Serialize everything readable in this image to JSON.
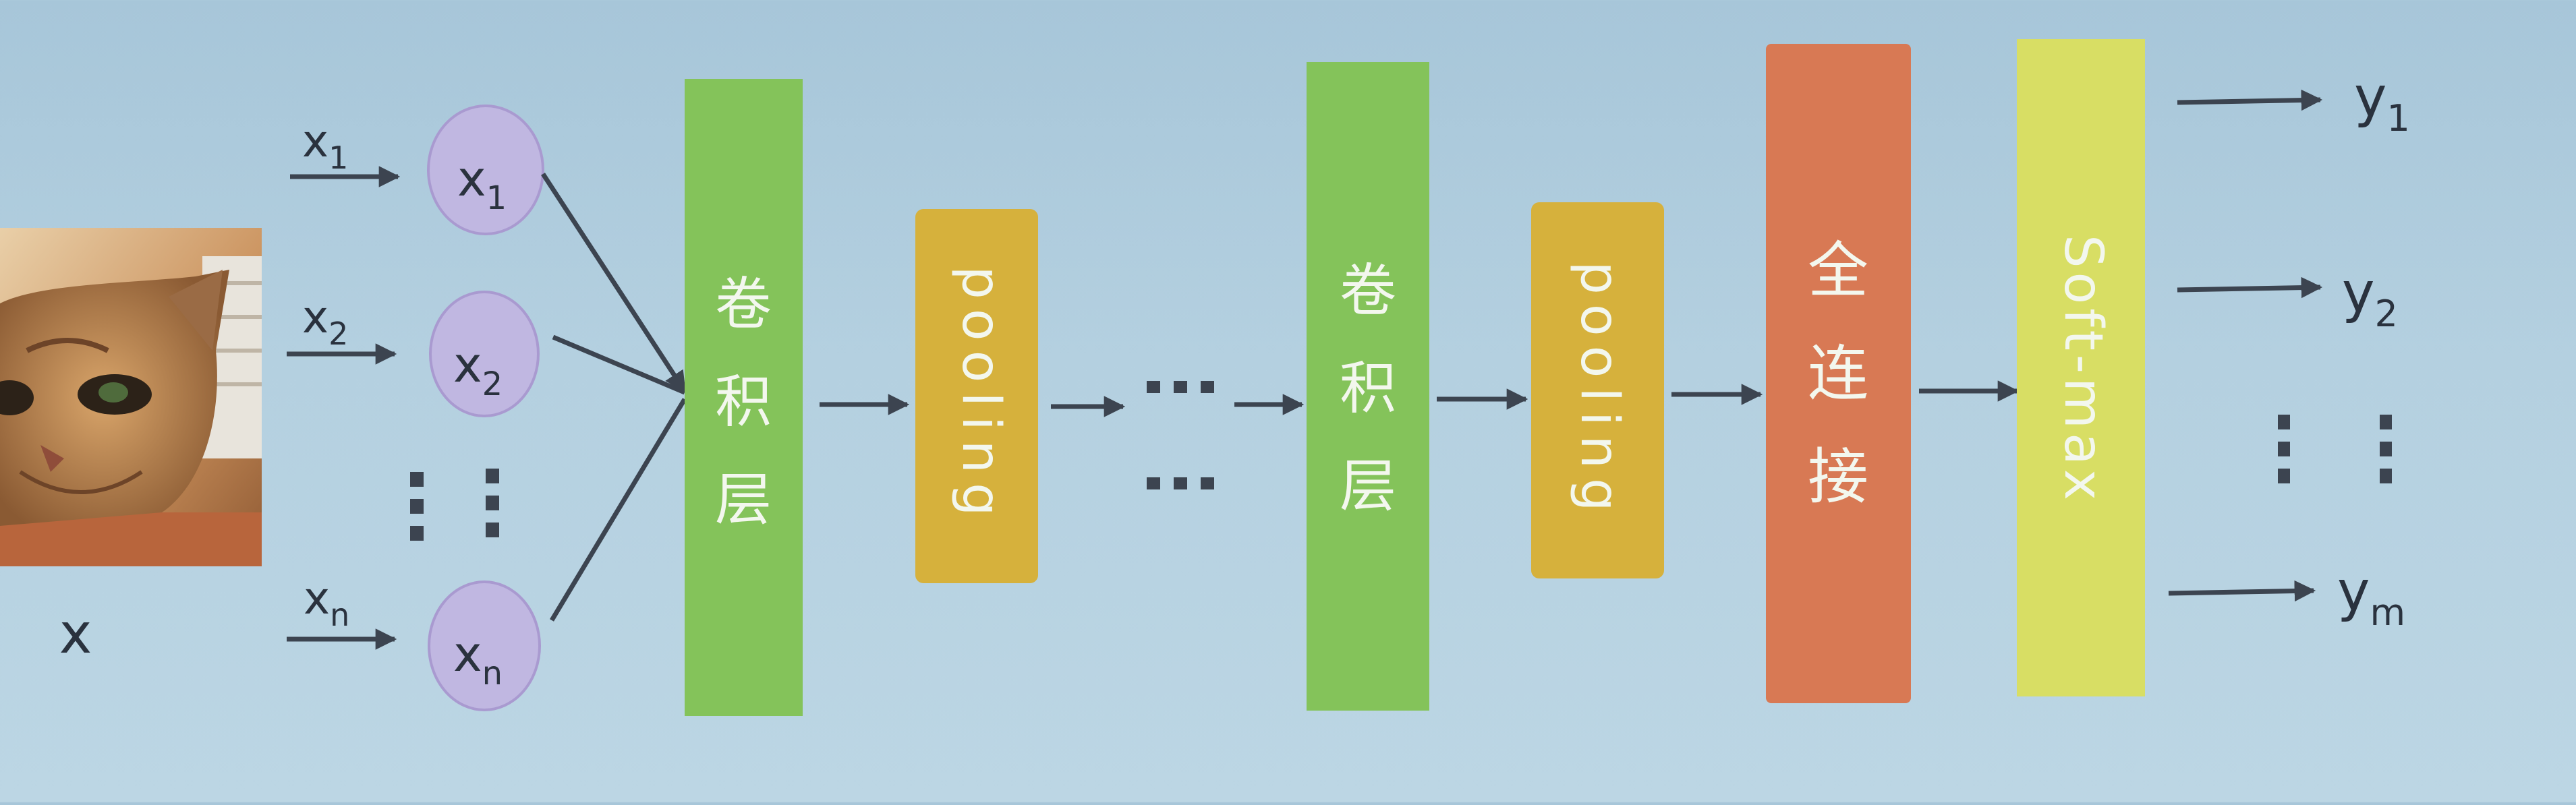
{
  "colors": {
    "conv": "#84c35a",
    "pool": "#d6b13c",
    "fc": "#d87954",
    "softmax": "#d8de64",
    "node": "#c0b7e1",
    "node_stroke": "#a99ad0",
    "arrow": "#3c4450",
    "label_light": "#f3f7ee",
    "text_dark": "#2a323e"
  },
  "input": {
    "image_label": "x",
    "image_icon": "cat-photo",
    "arrows": [
      {
        "base": "x",
        "sub": "1"
      },
      {
        "base": "x",
        "sub": "2"
      },
      {
        "base": "x",
        "sub": "n"
      }
    ],
    "nodes": [
      {
        "base": "x",
        "sub": "1"
      },
      {
        "base": "x",
        "sub": "2"
      },
      {
        "base": "x",
        "sub": "n"
      }
    ]
  },
  "layers": {
    "conv1": [
      "卷",
      "积",
      "层"
    ],
    "pool1": "pooling",
    "conv2": [
      "卷",
      "积",
      "层"
    ],
    "pool2": "pooling",
    "fc": [
      "全",
      "连",
      "接"
    ],
    "softmax": "Soft-max"
  },
  "outputs": [
    {
      "base": "y",
      "sub": "1"
    },
    {
      "base": "y",
      "sub": "2"
    },
    {
      "base": "y",
      "sub": "m"
    }
  ]
}
